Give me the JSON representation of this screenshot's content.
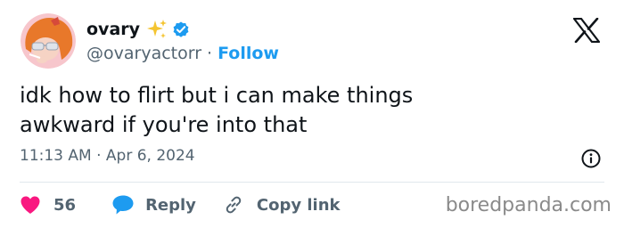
{
  "author": {
    "display_name": "ovary",
    "handle": "@ovaryactorr",
    "separator": "·",
    "follow_label": "Follow"
  },
  "tweet": {
    "line1": "idk how to flirt but i can make things",
    "line2": "awkward if you're into that",
    "timestamp": "11:13 AM · Apr 6, 2024"
  },
  "actions": {
    "likes_count": "56",
    "reply_label": "Reply",
    "copy_link_label": "Copy link"
  },
  "watermark": "boredpanda.com",
  "icons": {
    "sparkle": "sparkles-icon",
    "verified": "verified-badge-icon",
    "brand": "x-logo-icon",
    "info": "info-icon",
    "like": "heart-icon",
    "reply": "speech-bubble-icon",
    "copy": "link-icon"
  },
  "colors": {
    "accent_blue": "#1d9bf0",
    "heart_pink": "#f91880",
    "sparkle_gold": "#f4c430",
    "text_primary": "#0f1419",
    "text_secondary": "#536471"
  }
}
